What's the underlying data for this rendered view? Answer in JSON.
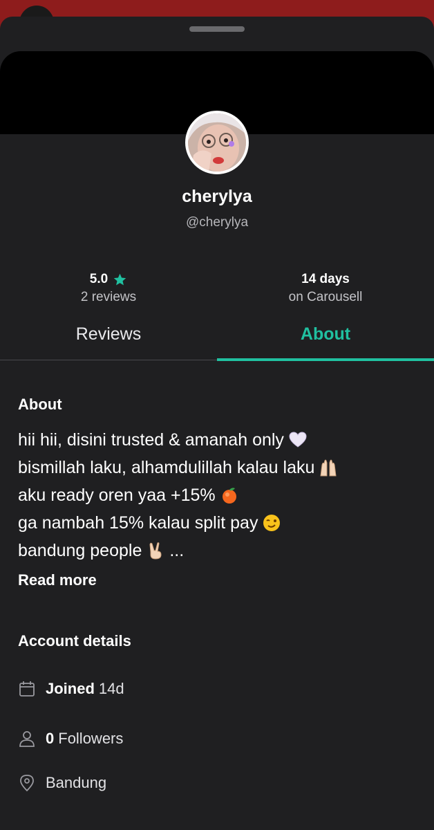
{
  "colors": {
    "accent": "#20c0a0",
    "sheet_background": "#1f1f21",
    "backdrop": "#8e1c1c"
  },
  "profile": {
    "display_name": "cherylya",
    "username": "@cherylya",
    "rating": "5.0",
    "reviews_count": "2 reviews",
    "tenure": "14 days",
    "tenure_suffix": "on Carousell"
  },
  "tabs": [
    {
      "label": "Reviews",
      "active": false
    },
    {
      "label": "About",
      "active": true
    }
  ],
  "about": {
    "heading": "About",
    "bio_lines": [
      {
        "text": "hii hii, disini trusted & amanah only",
        "emoji": "white-heart-icon"
      },
      {
        "text": "bismillah laku, alhamdulillah kalau laku",
        "emoji": "raised-hands-icon"
      },
      {
        "text": "aku ready oren yaa +15%",
        "emoji": "orange-icon"
      },
      {
        "text": "ga nambah 15% kalau split pay",
        "emoji": "winking-face-icon"
      },
      {
        "text": "bandung people",
        "emoji": "victory-hand-icon",
        "suffix": "..."
      }
    ],
    "read_more": "Read more"
  },
  "account_details": {
    "heading": "Account details",
    "joined_label": "Joined",
    "joined_value": "14d",
    "followers_count": "0",
    "followers_label": "Followers",
    "location": "Bandung"
  }
}
